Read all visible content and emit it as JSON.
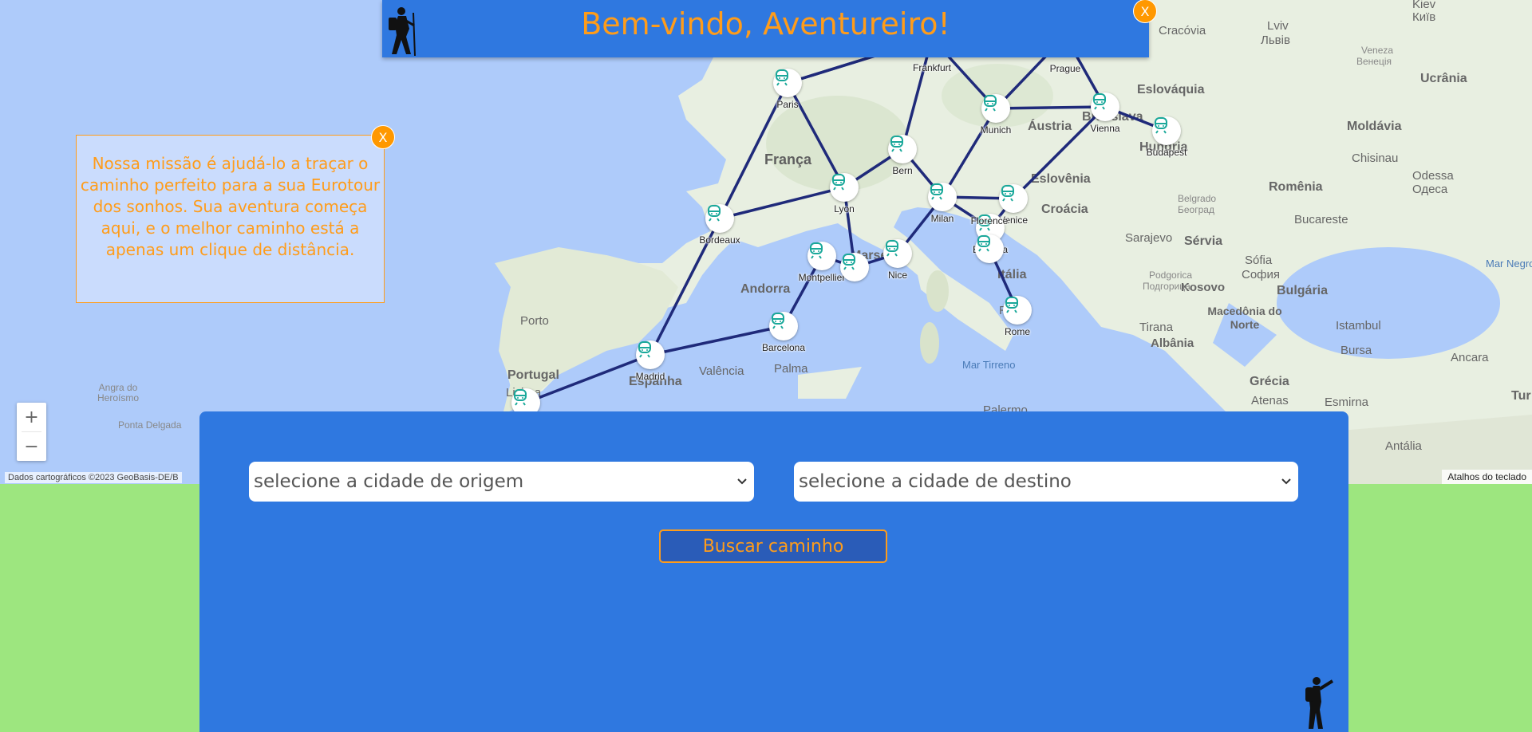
{
  "header": {
    "title": "Bem-vindo, Aventureiro!",
    "close_label": "X"
  },
  "mission": {
    "text": "Nossa missão é ajudá-lo a traçar o caminho perfeito para a sua Eurotour dos sonhos. Sua aventura começa aqui, e o melhor caminho está a apenas um clique de distância.",
    "close_label": "X"
  },
  "map": {
    "zoom_in": "+",
    "zoom_out": "−",
    "attribution": "Dados cartográficos ©2023 GeoBasis-DE/B",
    "shortcuts": "Atalhos do teclado",
    "route_color": "#1f2a7a",
    "station_icon_color": "#1aa89a",
    "stations": [
      "Paris",
      "Frankfurt",
      "Prague",
      "Munich",
      "Vienna",
      "Budapest",
      "Bern",
      "Lyon",
      "Bordeaux",
      "Milan",
      "Venice",
      "Bologna",
      "Florence",
      "Nice",
      "Montpellier",
      "Barcelona",
      "Madrid",
      "Rome"
    ],
    "base_labels": {
      "countries": [
        "França",
        "Áustria",
        "Eslováquia",
        "Ucrânia",
        "Moldávia",
        "Romênia",
        "Eslovênia",
        "Croácia",
        "Hungria",
        "Sérvia",
        "Bulgária",
        "Kosovo",
        "Albânia",
        "Grécia",
        "Andorra",
        "Portugal",
        "Espanha",
        "Itália",
        "Macedônia do Norte"
      ],
      "cities": [
        "Kiev",
        "Київ",
        "Lviv",
        "Львів",
        "Cracóvia",
        "Veneza",
        "Венеція",
        "Chisinau",
        "Odessa",
        "Одеса",
        "Belgrado",
        "Београд",
        "Sarajevo",
        "Bucareste",
        "Sófia",
        "София",
        "Podgorica",
        "Подгорица",
        "Tirana",
        "Istambul",
        "Bursa",
        "Ancara",
        "Esmirna",
        "Atenas",
        "Antália",
        "Valência",
        "Palma",
        "Porto",
        "Lisboa",
        "Angra do Heroísmo",
        "Ponta Delgada",
        "Palermo",
        "Roma",
        "Mar Tirreno",
        "Mar Negro",
        "Tur",
        "Marseille",
        "Bratislava"
      ]
    }
  },
  "search": {
    "origin_placeholder": "selecione a cidade de origem",
    "destination_placeholder": "selecione a cidade de destino",
    "button_label": "Buscar caminho"
  },
  "colors": {
    "panel": "#2f78e0",
    "accent": "#ff9c1a",
    "ground": "#9de67f"
  }
}
